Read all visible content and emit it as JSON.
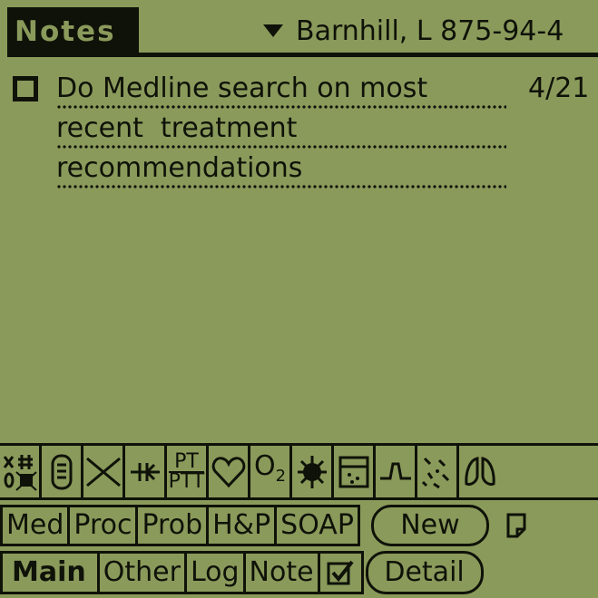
{
  "header": {
    "app_title": "Notes",
    "patient_selector": "Barnhill, L 875-94-4",
    "dropdown_icon": "triangle-down-icon"
  },
  "todo": {
    "items": [
      {
        "checked": false,
        "lines": [
          "Do Medline search on most",
          "recent  treatment",
          "recommendations"
        ],
        "date": "4/21"
      }
    ]
  },
  "icon_strip": {
    "icons": [
      {
        "name": "lab-grid-icon"
      },
      {
        "name": "tube-icon"
      },
      {
        "name": "cross-lines-icon"
      },
      {
        "name": "arrows-icon"
      },
      {
        "name": "pt-ptt-icon",
        "line1": "PT",
        "line2": "PTT"
      },
      {
        "name": "heart-icon"
      },
      {
        "name": "o2-icon",
        "text": "O",
        "sub": "2"
      },
      {
        "name": "splat-icon"
      },
      {
        "name": "box-icon"
      },
      {
        "name": "pulse-icon"
      },
      {
        "name": "scatter-icon"
      },
      {
        "name": "lungs-icon"
      }
    ]
  },
  "buttons_row1": {
    "med": "Med",
    "proc": "Proc",
    "prob": "Prob",
    "hp": "H&P",
    "soap": "SOAP",
    "new": "New"
  },
  "buttons_row2": {
    "main": "Main",
    "other": "Other",
    "log": "Log",
    "note": "Note",
    "detail": "Detail"
  },
  "colors": {
    "screen": "#8a9a5b",
    "ink": "#0f1208"
  }
}
